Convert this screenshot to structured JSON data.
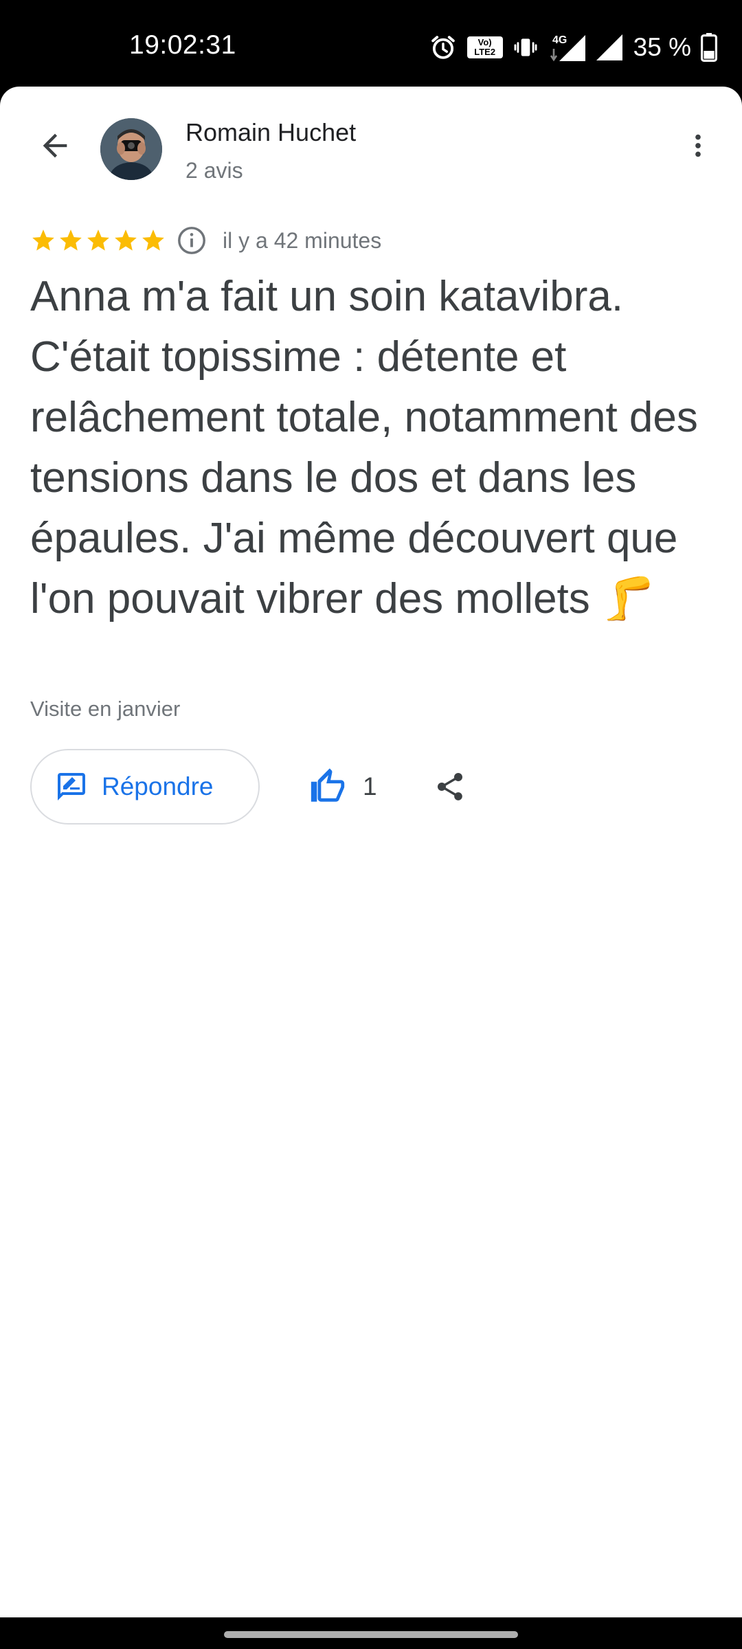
{
  "status_bar": {
    "time": "19:02:31",
    "network": "4G",
    "volte_line1": "Vo)",
    "volte_line2": "LTE2",
    "battery": "35 %",
    "icons": [
      "alarm-icon",
      "volte-icon",
      "vibrate-icon",
      "signal-4g-icon",
      "signal-icon",
      "battery-icon"
    ]
  },
  "header": {
    "back_icon": "arrow-back-icon",
    "reviewer_name": "Romain Huchet",
    "review_count": "2 avis",
    "more_icon": "more-vert-icon"
  },
  "review": {
    "rating": 5,
    "max_rating": 5,
    "time_ago": "il y a 42 minutes",
    "text": "Anna m'a fait un soin katavibra. C'était topissime : détente et relâchement totale, notamment des tensions dans le dos et dans les épaules. J'ai même découvert que l'on pouvait vibrer des mollets 🦵",
    "visit": "Visite en janvier"
  },
  "actions": {
    "reply_label": "Répondre",
    "like_count": "1"
  },
  "colors": {
    "star": "#fbbc04",
    "accent": "#1a73e8",
    "text_primary": "#202124",
    "text_body": "#3c4043",
    "text_secondary": "#70757a",
    "border": "#dadce0"
  }
}
